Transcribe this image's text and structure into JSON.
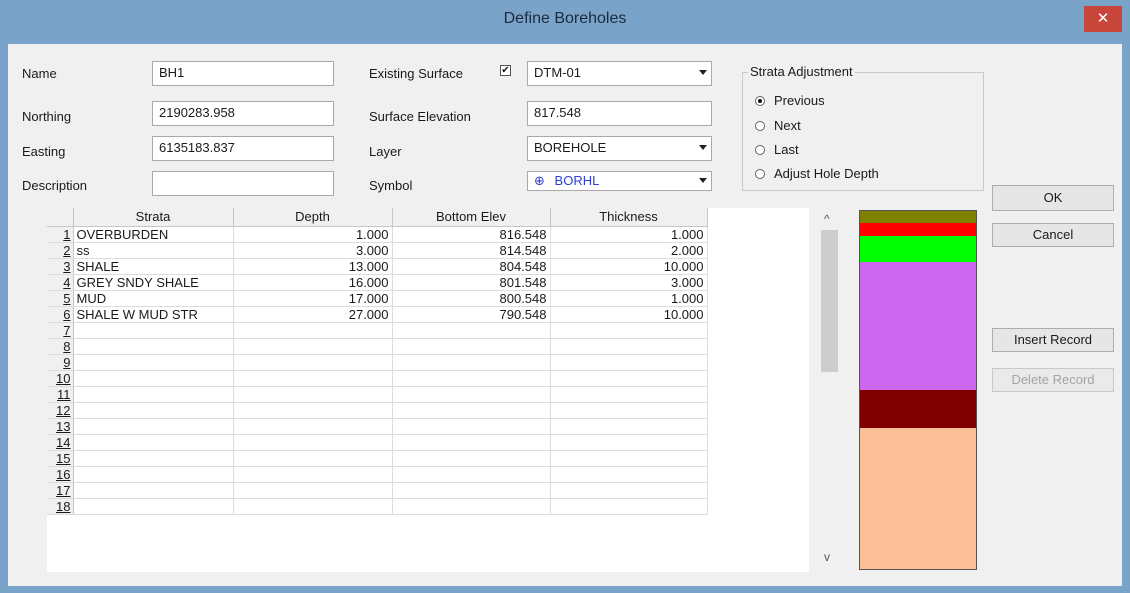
{
  "window": {
    "title": "Define Boreholes",
    "close": "✕"
  },
  "form": {
    "name_label": "Name",
    "name_value": "BH1",
    "northing_label": "Northing",
    "northing_value": "2190283.958",
    "easting_label": "Easting",
    "easting_value": "6135183.837",
    "description_label": "Description",
    "description_value": "",
    "existing_surface_label": "Existing Surface",
    "existing_surface_checked": true,
    "existing_surface_value": "DTM-01",
    "surface_elevation_label": "Surface Elevation",
    "surface_elevation_value": "817.548",
    "layer_label": "Layer",
    "layer_value": "BOREHOLE",
    "symbol_label": "Symbol",
    "symbol_glyph": "⊕",
    "symbol_value": "BORHL"
  },
  "strata_adjustment": {
    "title": "Strata Adjustment",
    "options": [
      {
        "label": "Previous",
        "selected": true
      },
      {
        "label": "Next",
        "selected": false
      },
      {
        "label": "Last",
        "selected": false
      },
      {
        "label": "Adjust Hole Depth",
        "selected": false
      }
    ]
  },
  "buttons": {
    "ok": "OK",
    "cancel": "Cancel",
    "insert": "Insert Record",
    "delete": "Delete Record"
  },
  "grid": {
    "headers": [
      "Strata",
      "Depth",
      "Bottom Elev",
      "Thickness"
    ],
    "row_numbers": [
      "1",
      "2",
      "3",
      "4",
      "5",
      "6",
      "7",
      "8",
      "9",
      "10",
      "11",
      "12",
      "13",
      "14",
      "15",
      "16",
      "17",
      "18"
    ],
    "rows": [
      [
        "OVERBURDEN",
        "1.000",
        "816.548",
        "1.000"
      ],
      [
        "ss",
        "3.000",
        "814.548",
        "2.000"
      ],
      [
        "SHALE",
        "13.000",
        "804.548",
        "10.000"
      ],
      [
        "GREY SNDY SHALE",
        "16.000",
        "801.548",
        "3.000"
      ],
      [
        "MUD",
        "17.000",
        "800.548",
        "1.000"
      ],
      [
        "SHALE W MUD STR",
        "27.000",
        "790.548",
        "10.000"
      ]
    ]
  },
  "column_colors": [
    "#808000",
    "#ff0000",
    "#00ff00",
    "#cc66ee",
    "#800000",
    "#fbbf97"
  ]
}
